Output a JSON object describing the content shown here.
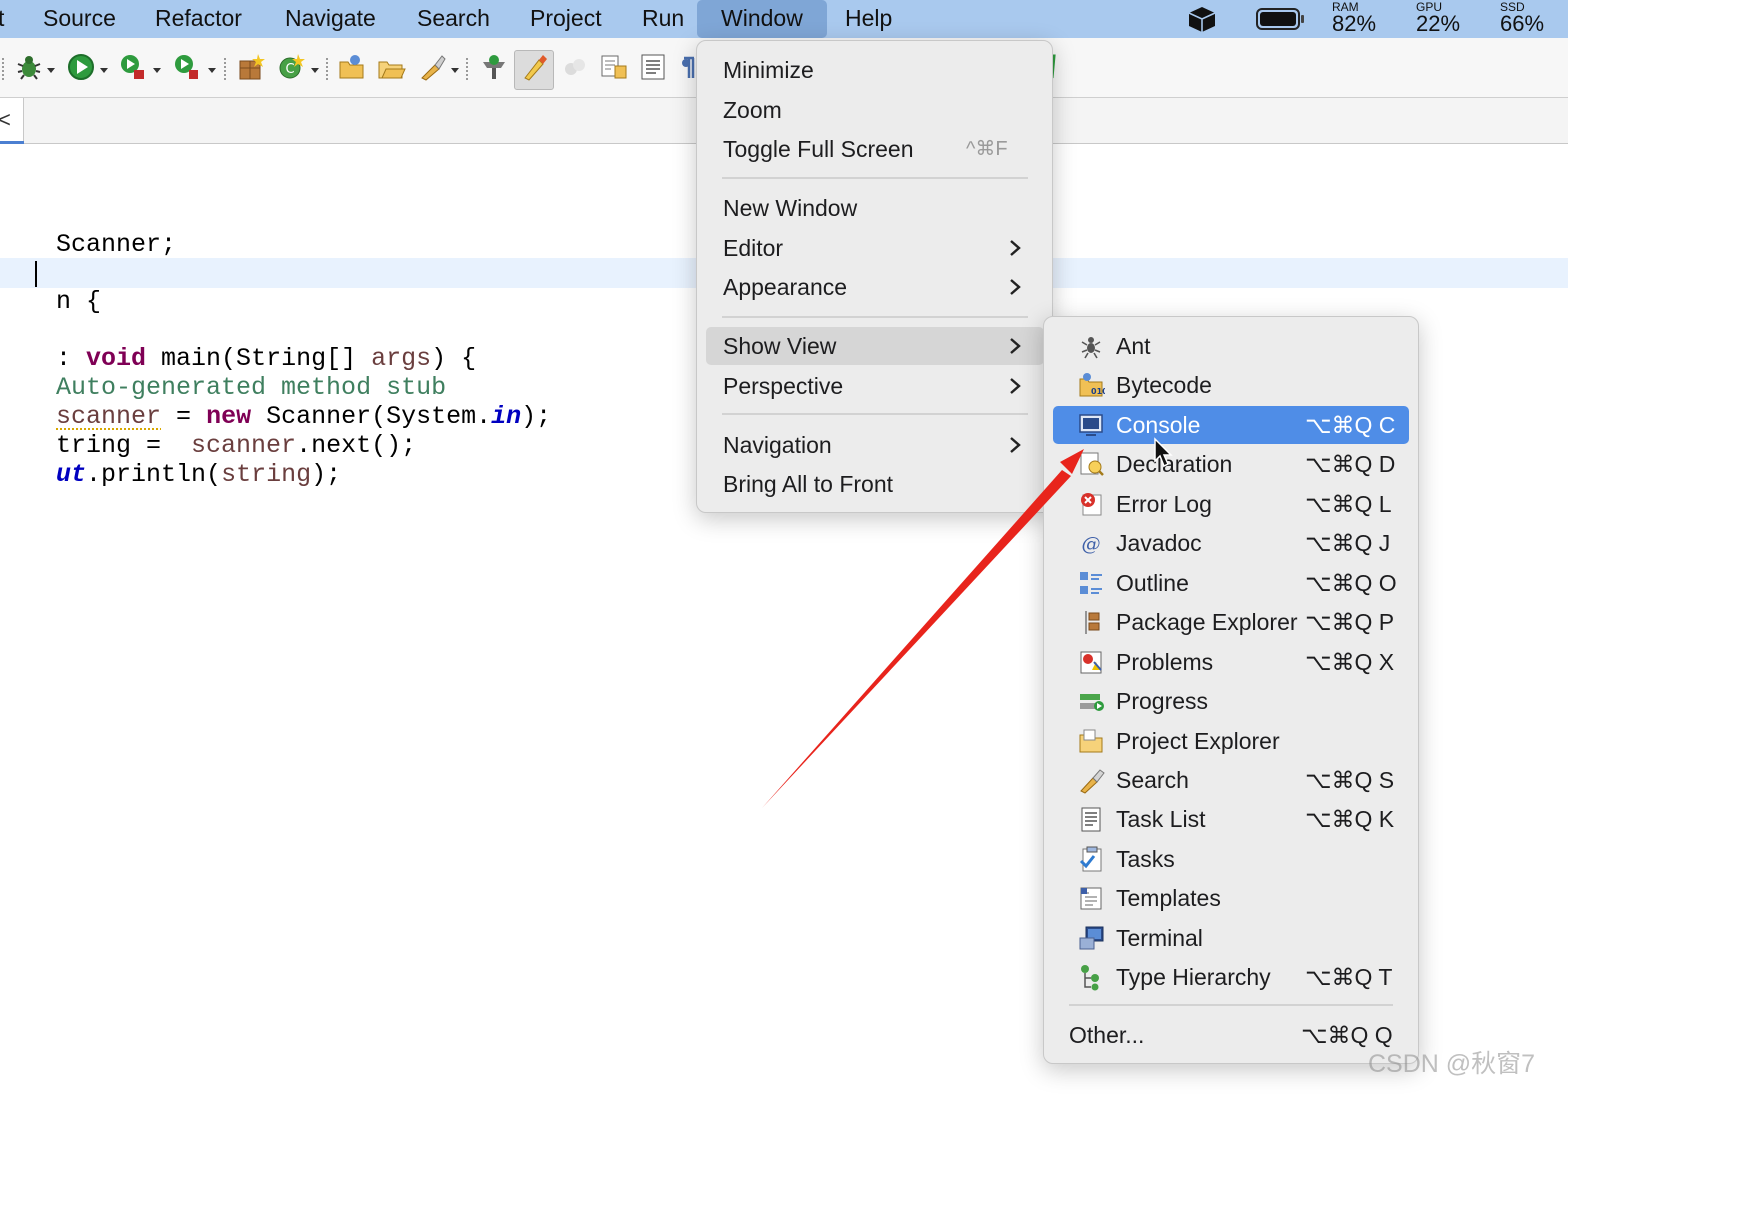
{
  "menubar": {
    "items": [
      {
        "label": "t"
      },
      {
        "label": "Source"
      },
      {
        "label": "Refactor"
      },
      {
        "label": "Navigate"
      },
      {
        "label": "Search"
      },
      {
        "label": "Project"
      },
      {
        "label": "Run"
      },
      {
        "label": "Window",
        "active": true
      },
      {
        "label": "Help"
      }
    ],
    "status": {
      "ram": {
        "label": "RAM",
        "value": "82%"
      },
      "gpu": {
        "label": "GPU",
        "value": "22%"
      },
      "ssd": {
        "label": "SSD",
        "value": "66%"
      }
    },
    "icons": [
      "cube-icon",
      "battery-icon"
    ]
  },
  "editor": {
    "tab_close": "<",
    "lines": [
      "Scanner;",
      "n {",
      ": void main(String[] args) {",
      "Auto-generated method stub",
      "scanner = new Scanner(System.in);",
      "tring =  scanner.next();",
      "ut.println(string);"
    ]
  },
  "window_menu": {
    "items": [
      {
        "label": "Minimize"
      },
      {
        "label": "Zoom"
      },
      {
        "label": "Toggle Full Screen",
        "shortcut": "^⌘F"
      },
      {
        "label": "New Window"
      },
      {
        "label": "Editor",
        "submenu": true
      },
      {
        "label": "Appearance",
        "submenu": true
      },
      {
        "label": "Show View",
        "submenu": true,
        "highlighted": true
      },
      {
        "label": "Perspective",
        "submenu": true
      },
      {
        "label": "Navigation",
        "submenu": true
      },
      {
        "label": "Bring All to Front"
      }
    ]
  },
  "show_view_menu": {
    "items": [
      {
        "label": "Ant",
        "shortcut": "",
        "icon": "ant-icon"
      },
      {
        "label": "Bytecode",
        "shortcut": "",
        "icon": "bytecode-icon"
      },
      {
        "label": "Console",
        "shortcut": "⌥⌘Q C",
        "icon": "console-icon",
        "selected": true
      },
      {
        "label": "Declaration",
        "shortcut": "⌥⌘Q D",
        "icon": "declaration-icon"
      },
      {
        "label": "Error Log",
        "shortcut": "⌥⌘Q L",
        "icon": "error-log-icon"
      },
      {
        "label": "Javadoc",
        "shortcut": "⌥⌘Q J",
        "icon": "javadoc-icon"
      },
      {
        "label": "Outline",
        "shortcut": "⌥⌘Q O",
        "icon": "outline-icon"
      },
      {
        "label": "Package Explorer",
        "shortcut": "⌥⌘Q P",
        "icon": "package-explorer-icon"
      },
      {
        "label": "Problems",
        "shortcut": "⌥⌘Q X",
        "icon": "problems-icon"
      },
      {
        "label": "Progress",
        "shortcut": "",
        "icon": "progress-icon"
      },
      {
        "label": "Project Explorer",
        "shortcut": "",
        "icon": "project-explorer-icon"
      },
      {
        "label": "Search",
        "shortcut": "⌥⌘Q S",
        "icon": "search-view-icon"
      },
      {
        "label": "Task List",
        "shortcut": "⌥⌘Q K",
        "icon": "task-list-icon"
      },
      {
        "label": "Tasks",
        "shortcut": "",
        "icon": "tasks-icon"
      },
      {
        "label": "Templates",
        "shortcut": "",
        "icon": "templates-icon"
      },
      {
        "label": "Terminal",
        "shortcut": "",
        "icon": "terminal-icon"
      },
      {
        "label": "Type Hierarchy",
        "shortcut": "⌥⌘Q T",
        "icon": "type-hierarchy-icon"
      }
    ],
    "other": {
      "label": "Other...",
      "shortcut": "⌥⌘Q Q"
    }
  },
  "watermark": "CSDN @秋窗7",
  "colors": {
    "menubar": "#a9c9ee",
    "selection": "#4f8de7",
    "annotation_arrow": "#e8241c"
  }
}
